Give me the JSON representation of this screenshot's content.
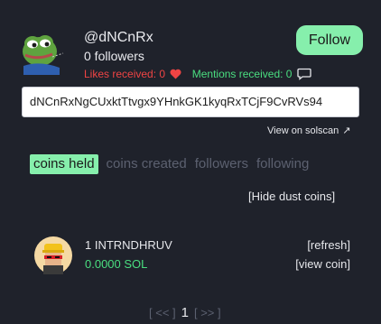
{
  "profile": {
    "username": "@dNCnRx",
    "followers": "0 followers",
    "likes": "Likes received: 0",
    "mentions": "Mentions received: 0",
    "follow_label": "Follow",
    "address": "dNCnRxNgCUxktTtvgx9YHnkGK1kyqRxTCjF9CvRVs94",
    "solscan_label": "View on solscan"
  },
  "tabs": [
    {
      "label": "coins held"
    },
    {
      "label": "coins created"
    },
    {
      "label": "followers"
    },
    {
      "label": "following"
    }
  ],
  "hide_dust_label": "[Hide dust coins]",
  "coins": [
    {
      "name": "1 INTRNDHRUV",
      "sol": "0.0000 SOL",
      "refresh_label": "[refresh]",
      "view_label": "[view coin]"
    }
  ],
  "pagination": {
    "prev": "[ << ]",
    "current": "1",
    "next": "[ >> ]"
  },
  "colors": {
    "background": "#1f222b",
    "accent_green": "#86efac",
    "likes_red": "#ef4444",
    "mentions_green": "#4ade80",
    "muted": "#5c6170"
  },
  "icons": [
    "pepe-avatar",
    "heart-icon",
    "speech-bubble-icon",
    "external-link-icon",
    "coin-avatar"
  ]
}
